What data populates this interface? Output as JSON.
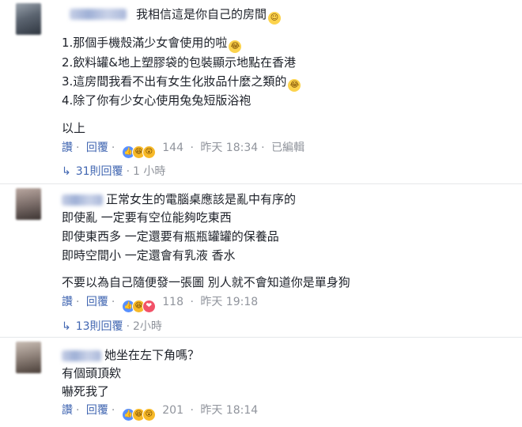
{
  "comments": [
    {
      "title_text": "我相信這是你自己的房間",
      "title_emoji": "🤭",
      "lines": [
        {
          "text": "1.那個手機殼滿少女會使用的啦",
          "emoji": "😂"
        },
        {
          "text": "2.飲料罐&地上塑膠袋的包裝顯示地點在香港",
          "emoji": ""
        },
        {
          "text": "3.這房間我看不出有女生化妝品什麼之類的",
          "emoji": "😂"
        },
        {
          "text": "4.除了你有少女心使用兔兔短版浴袍",
          "emoji": ""
        },
        {
          "text": "以上",
          "emoji": ""
        }
      ],
      "actions": {
        "like": "讚",
        "reply": "回覆",
        "count": "144",
        "time": "昨天 18:34",
        "edited": "已編輯"
      },
      "replies": {
        "label": "31則回覆",
        "time": "1 小時"
      }
    },
    {
      "title_text": "正常女生的電腦桌應該是亂中有序的",
      "lines": [
        {
          "text": "即使亂 一定要有空位能夠吃東西"
        },
        {
          "text": "即使東西多 一定還要有瓶瓶罐罐的保養品"
        },
        {
          "text": "即時空間小 一定還會有乳液 香水"
        },
        {
          "text": "不要以為自己隨便發一張圖 別人就不會知道你是單身狗"
        }
      ],
      "actions": {
        "like": "讚",
        "reply": "回覆",
        "count": "118",
        "time": "昨天 19:18"
      },
      "replies": {
        "label": "13則回覆",
        "time": "2小時"
      }
    },
    {
      "title_text": "她坐在左下角嗎？",
      "lines": [
        {
          "text": "有個頭頂欸"
        },
        {
          "text": "嚇死我了"
        }
      ],
      "actions": {
        "like": "讚",
        "reply": "回覆",
        "count": "201",
        "time": "昨天 18:14"
      }
    }
  ],
  "reactions": {
    "like": "👍",
    "haha": "😆",
    "wow": "😮",
    "love": "❤"
  }
}
